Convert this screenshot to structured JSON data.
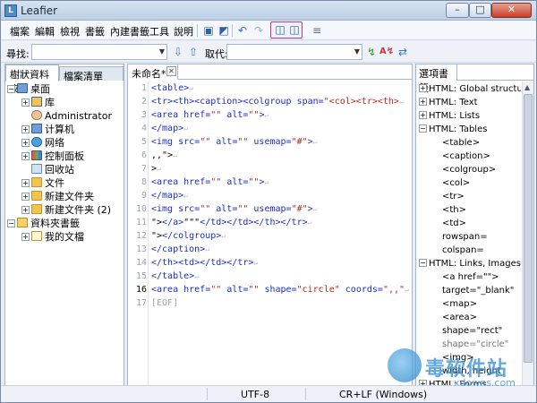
{
  "window": {
    "title": "Leafier",
    "min_label": "–",
    "max_label": "□",
    "close_label": "✕"
  },
  "menu": [
    "檔案",
    "編輯",
    "檢視",
    "書籤",
    "內建書籤",
    "工具",
    "說明"
  ],
  "search": {
    "find_label": "尋找:",
    "find_value": "",
    "replace_label": "取代:",
    "replace_value": ""
  },
  "left_tabs": [
    "樹狀資料夾",
    "檔案清單"
  ],
  "tree": [
    {
      "label": "桌面",
      "icon": "desktop-icon",
      "expand": "−",
      "level": 0
    },
    {
      "label": "库",
      "icon": "library-icon",
      "expand": "+",
      "level": 1
    },
    {
      "label": "Administrator",
      "icon": "user-icon",
      "expand": "",
      "level": 1
    },
    {
      "label": "计算机",
      "icon": "computer-icon",
      "expand": "+",
      "level": 1
    },
    {
      "label": "网络",
      "icon": "network-icon",
      "expand": "+",
      "level": 1
    },
    {
      "label": "控制面板",
      "icon": "control-panel-icon",
      "expand": "+",
      "level": 1
    },
    {
      "label": "回收站",
      "icon": "recycle-bin-icon",
      "expand": "",
      "level": 1
    },
    {
      "label": "文件",
      "icon": "folder-icon",
      "expand": "+",
      "level": 1
    },
    {
      "label": "新建文件夹",
      "icon": "folder-icon",
      "expand": "+",
      "level": 1
    },
    {
      "label": "新建文件夹 (2)",
      "icon": "folder-icon",
      "expand": "+",
      "level": 1
    },
    {
      "label": "資料夾書籤",
      "icon": "bookmark-folder-icon",
      "expand": "−",
      "level": 0
    },
    {
      "label": "我的文檔",
      "icon": "documents-icon",
      "expand": "+",
      "level": 1
    }
  ],
  "editor": {
    "tab_label": "未命名*",
    "lines": [
      {
        "n": "1",
        "parts": [
          {
            "c": "tag",
            "t": "<table>"
          }
        ]
      },
      {
        "n": "2",
        "parts": [
          {
            "c": "tag",
            "t": "<tr><th><caption><colgroup span="
          },
          {
            "c": "str",
            "t": "\"<col><tr><th>"
          }
        ]
      },
      {
        "n": "3",
        "parts": [
          {
            "c": "tag",
            "t": "<area href="
          },
          {
            "c": "str",
            "t": "\"\""
          },
          {
            "c": "tag",
            "t": " alt="
          },
          {
            "c": "str",
            "t": "\"\""
          },
          {
            "c": "tag",
            "t": ">"
          }
        ]
      },
      {
        "n": "4",
        "parts": [
          {
            "c": "tag",
            "t": "</map>"
          }
        ]
      },
      {
        "n": "5",
        "parts": [
          {
            "c": "tag",
            "t": "<img src="
          },
          {
            "c": "str",
            "t": "\"\""
          },
          {
            "c": "tag",
            "t": " alt="
          },
          {
            "c": "str",
            "t": "\"\""
          },
          {
            "c": "tag",
            "t": " usemap="
          },
          {
            "c": "str",
            "t": "\"#\""
          },
          {
            "c": "tag",
            "t": ">"
          }
        ]
      },
      {
        "n": "6",
        "parts": [
          {
            "c": "txt",
            "t": ",,\">"
          }
        ]
      },
      {
        "n": "7",
        "parts": [
          {
            "c": "txt",
            "t": ">"
          }
        ]
      },
      {
        "n": "8",
        "parts": [
          {
            "c": "tag",
            "t": "<area href="
          },
          {
            "c": "str",
            "t": "\"\""
          },
          {
            "c": "tag",
            "t": " alt="
          },
          {
            "c": "str",
            "t": "\"\""
          },
          {
            "c": "tag",
            "t": ">"
          }
        ]
      },
      {
        "n": "9",
        "parts": [
          {
            "c": "tag",
            "t": "</map>"
          }
        ]
      },
      {
        "n": "10",
        "parts": [
          {
            "c": "tag",
            "t": "<img src="
          },
          {
            "c": "str",
            "t": "\"\""
          },
          {
            "c": "tag",
            "t": " alt="
          },
          {
            "c": "str",
            "t": "\"\""
          },
          {
            "c": "tag",
            "t": " usemap="
          },
          {
            "c": "str",
            "t": "\"#\""
          },
          {
            "c": "tag",
            "t": ">"
          }
        ]
      },
      {
        "n": "11",
        "parts": [
          {
            "c": "txt",
            "t": "\">"
          },
          {
            "c": "tag",
            "t": "</a>"
          },
          {
            "c": "txt",
            "t": "\"\"\""
          },
          {
            "c": "tag",
            "t": "</td></td></th></tr>"
          }
        ]
      },
      {
        "n": "12",
        "parts": [
          {
            "c": "txt",
            "t": "\">"
          },
          {
            "c": "tag",
            "t": "</colgroup>"
          }
        ]
      },
      {
        "n": "13",
        "parts": [
          {
            "c": "tag",
            "t": "</caption>"
          }
        ]
      },
      {
        "n": "14",
        "parts": [
          {
            "c": "tag",
            "t": "</th><td></td></tr>"
          }
        ]
      },
      {
        "n": "15",
        "parts": [
          {
            "c": "tag",
            "t": "</table>"
          }
        ]
      },
      {
        "n": "16",
        "parts": [
          {
            "c": "tag",
            "t": "<area href="
          },
          {
            "c": "str",
            "t": "\"\""
          },
          {
            "c": "tag",
            "t": " alt="
          },
          {
            "c": "str",
            "t": "\"\""
          },
          {
            "c": "tag",
            "t": " shape="
          },
          {
            "c": "str",
            "t": "\"circle\""
          },
          {
            "c": "tag",
            "t": " coords="
          },
          {
            "c": "str",
            "t": "\",,\""
          }
        ]
      },
      {
        "n": "17",
        "parts": [
          {
            "c": "eof",
            "t": "[EOF]"
          }
        ]
      }
    ]
  },
  "right_panel": {
    "tab_label": "選項書籤",
    "items": [
      {
        "label": "HTML: Global structure",
        "expand": "+",
        "level": 0,
        "grey": false
      },
      {
        "label": "HTML: Text",
        "expand": "+",
        "level": 0,
        "grey": false
      },
      {
        "label": "HTML: Lists",
        "expand": "+",
        "level": 0,
        "grey": false
      },
      {
        "label": "HTML: Tables",
        "expand": "−",
        "level": 0,
        "grey": false
      },
      {
        "label": "<table>",
        "expand": "",
        "level": 1,
        "grey": false
      },
      {
        "label": "<caption>",
        "expand": "",
        "level": 1,
        "grey": false
      },
      {
        "label": "<colgroup>",
        "expand": "",
        "level": 1,
        "grey": false
      },
      {
        "label": "<col>",
        "expand": "",
        "level": 1,
        "grey": false
      },
      {
        "label": "<tr>",
        "expand": "",
        "level": 1,
        "grey": false
      },
      {
        "label": "<th>",
        "expand": "",
        "level": 1,
        "grey": false
      },
      {
        "label": "<td>",
        "expand": "",
        "level": 1,
        "grey": false
      },
      {
        "label": "rowspan=",
        "expand": "",
        "level": 1,
        "grey": false
      },
      {
        "label": "colspan=",
        "expand": "",
        "level": 1,
        "grey": false
      },
      {
        "label": "HTML: Links, Images",
        "expand": "−",
        "level": 0,
        "grey": false
      },
      {
        "label": "<a href=\"\">",
        "expand": "",
        "level": 1,
        "grey": false
      },
      {
        "label": "target=\"_blank\"",
        "expand": "",
        "level": 1,
        "grey": false
      },
      {
        "label": "<map>",
        "expand": "",
        "level": 1,
        "grey": false
      },
      {
        "label": "<area>",
        "expand": "",
        "level": 1,
        "grey": false
      },
      {
        "label": "shape=\"rect\"",
        "expand": "",
        "level": 1,
        "grey": false
      },
      {
        "label": "shape=\"circle\"",
        "expand": "",
        "level": 1,
        "grey": true
      },
      {
        "label": "<img>",
        "expand": "",
        "level": 1,
        "grey": false
      },
      {
        "label": "width, height",
        "expand": "",
        "level": 1,
        "grey": false
      },
      {
        "label": "HTML: Forms",
        "expand": "+",
        "level": 0,
        "grey": false
      }
    ]
  },
  "status": {
    "encoding": "UTF-8",
    "line_ending": "CR+LF (Windows)"
  },
  "watermark": {
    "text": "毒软件站",
    "url": "xdowns.com"
  },
  "colors": {
    "tag": "#1d2fbd",
    "string": "#b52a1f",
    "accent": "#b03a8f",
    "title_bar": "#bcd0e6"
  }
}
